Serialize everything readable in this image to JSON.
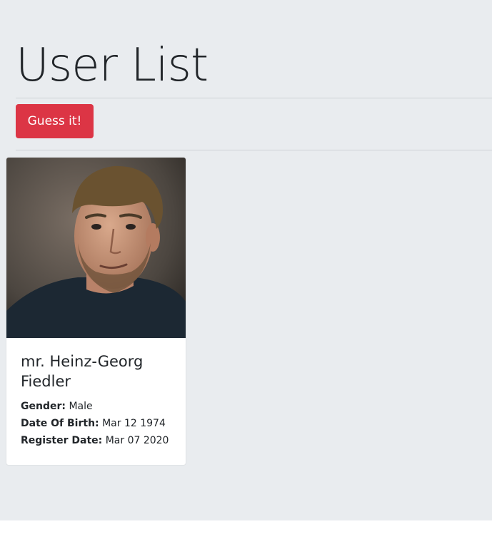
{
  "header": {
    "title": "User List",
    "guess_button_label": "Guess it!"
  },
  "users": [
    {
      "name": "mr. Heinz-Georg Fiedler",
      "photo_icon": "user-photo-icon",
      "gender_label": "Gender:",
      "gender": "Male",
      "dob_label": "Date Of Birth:",
      "dob": "Mar 12 1974",
      "register_label": "Register Date:",
      "register": "Mar 07 2020"
    }
  ],
  "colors": {
    "background": "#e9ecef",
    "danger": "#dc3545",
    "card": "#ffffff",
    "text": "#212529"
  }
}
